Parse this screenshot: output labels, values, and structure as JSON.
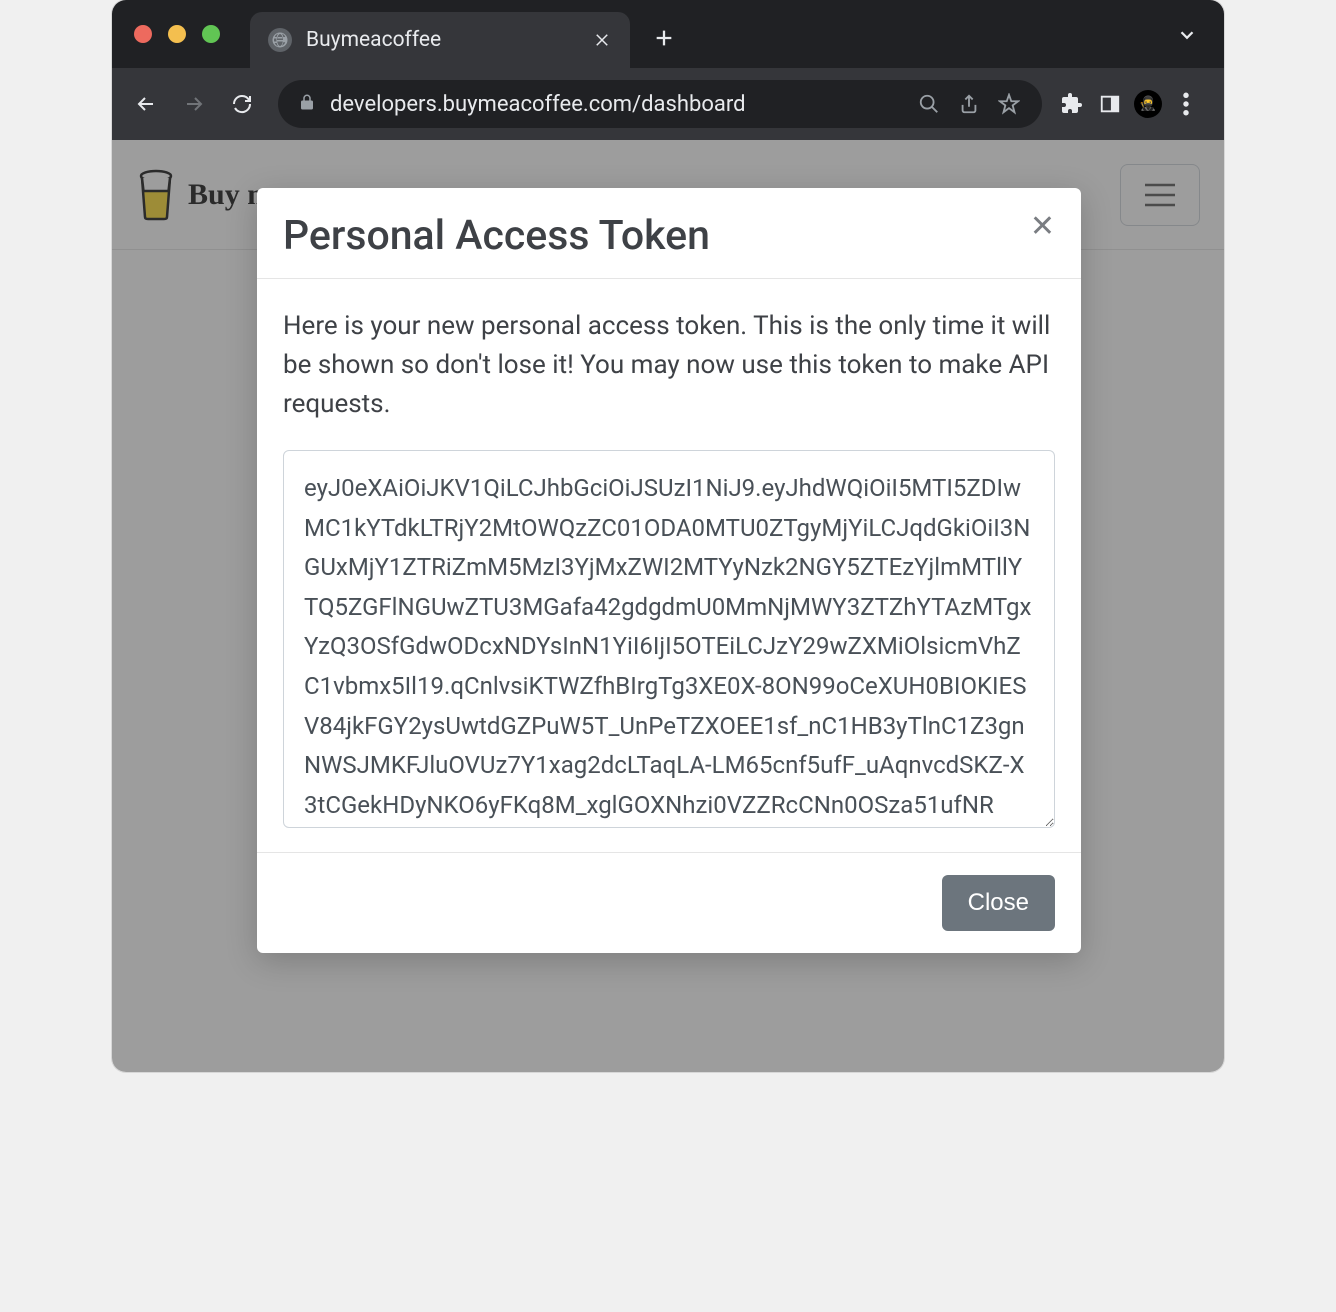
{
  "browser": {
    "tab_title": "Buymeacoffee",
    "url": "developers.buymeacoffee.com/dashboard"
  },
  "page": {
    "brand_text": "Buy m"
  },
  "modal": {
    "title": "Personal Access Token",
    "description": "Here is your new personal access token. This is the only time it will be shown so don't lose it! You may now use this token to make API requests.",
    "token": "eyJ0eXAiOiJKV1QiLCJhbGciOiJSUzI1NiJ9.eyJhdWQiOiI5MTI5ZDIwMC1kYTdkLTRjY2MtOWQzZC01ODA0MTU0ZTgyMjYiLCJqdGkiOiI3NGUxMjY1ZTRiZmM5MzI3YjMxZWI2MTYyNzk2NGY5ZTEzYjlmMTllYTQ5ZGFlNGUwZTU3MGafa42gdgdmU0MmNjMWY3ZTZhYTAzMTgxYzQ3OSfGdwODcxNDYsInN1YiI6IjI5OTEiLCJzY29wZXMiOlsicmVhZC1vbmx5Il19.qCnlvsiKTWZfhBIrgTg3XE0X-8ON99oCeXUH0BIOKIESV84jkFGY2ysUwtdGZPuW5T_UnPeTZXOEE1sf_nC1HB3yTlnC1Z3gnNWSJMKFJluOVUz7Y1xag2dcLTaqLA-LM65cnf5ufF_uAqnvcdSKZ-X3tCGekHDyNKO6yFKq8M_xglGOXNhzi0VZZRcCNn0OSza51ufNR",
    "close_label": "Close"
  }
}
